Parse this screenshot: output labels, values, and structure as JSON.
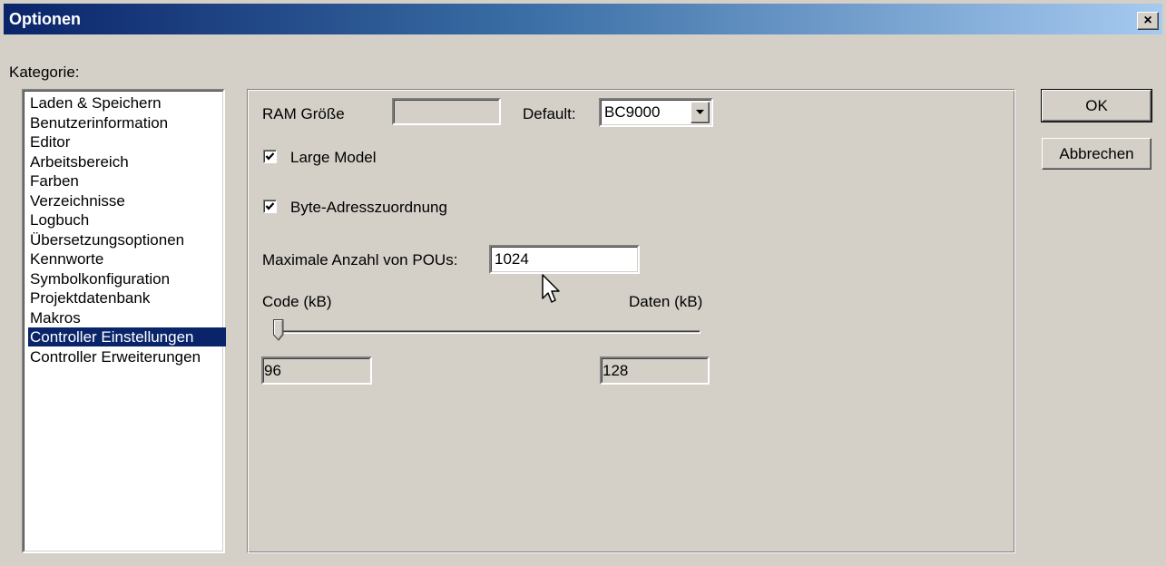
{
  "window": {
    "title": "Optionen",
    "close_glyph": "×"
  },
  "category": {
    "label": "Kategorie:",
    "items": [
      "Laden & Speichern",
      "Benutzerinformation",
      "Editor",
      "Arbeitsbereich",
      "Farben",
      "Verzeichnisse",
      "Logbuch",
      "Übersetzungsoptionen",
      "Kennworte",
      "Symbolkonfiguration",
      "Projektdatenbank",
      "Makros",
      "Controller Einstellungen",
      "Controller Erweiterungen"
    ],
    "selected": "Controller Einstellungen"
  },
  "settings": {
    "ram_label": "RAM Größe",
    "ram_value": "",
    "default_label": "Default:",
    "default_value": "BC9000",
    "large_model_label": "Large Model",
    "large_model_checked": true,
    "byte_label": "Byte-Adresszuordnung",
    "byte_checked": true,
    "max_pous_label": "Maximale Anzahl von POUs:",
    "max_pous_value": "1024",
    "code_label": "Code (kB)",
    "daten_label": "Daten (kB)",
    "code_value": "96",
    "daten_value": "128",
    "slider_fraction": 0.0
  },
  "buttons": {
    "ok": "OK",
    "cancel": "Abbrechen"
  },
  "colors": {
    "selection": "#0a246a",
    "face": "#d4d0c8",
    "title_start": "#0a246a",
    "title_end": "#a6caf0"
  }
}
